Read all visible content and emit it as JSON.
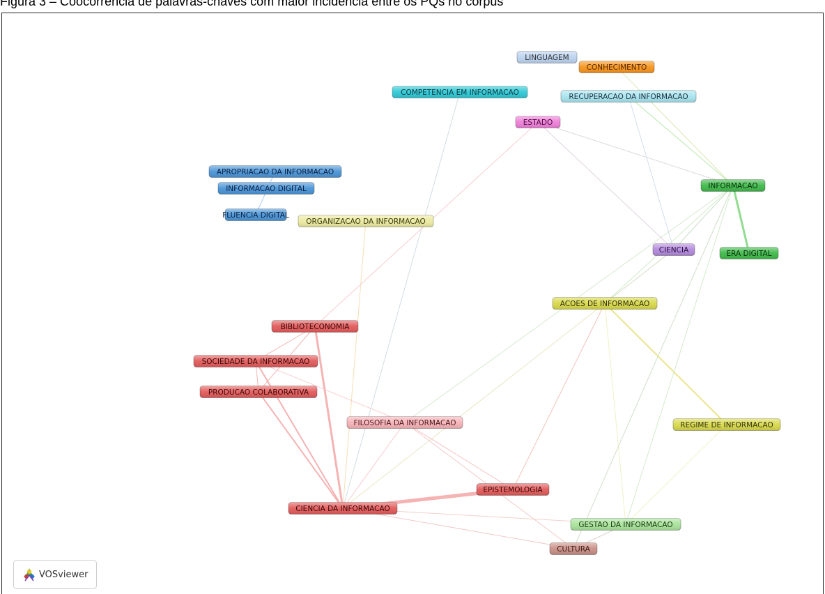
{
  "caption": "Figura 3 – Coocorrência de palavras-chaves com maior incidência entre os PQs no corpus",
  "logo_text": "VOSviewer",
  "nodes": [
    {
      "id": "linguagem",
      "label": "LINGUAGEM",
      "color": "#bcd3ef",
      "text": "#333"
    },
    {
      "id": "conhecimento",
      "label": "CONHECIMENTO",
      "color": "#f7941d",
      "text": "#5a2a00"
    },
    {
      "id": "competencia",
      "label": "COMPETENCIA EM INFORMACAO",
      "color": "#2ec8d6",
      "text": "#0b3a40"
    },
    {
      "id": "recuperacao",
      "label": "RECUPERACAO DA INFORMACAO",
      "color": "#a7e4ee",
      "text": "#234"
    },
    {
      "id": "estado",
      "label": "ESTADO",
      "color": "#ee7fd8",
      "text": "#4a0a3d"
    },
    {
      "id": "apropriacao",
      "label": "APROPRIACAO DA INFORMACAO",
      "color": "#4a94d6",
      "text": "#0b1f40"
    },
    {
      "id": "infodigital",
      "label": "INFORMACAO DIGITAL",
      "color": "#4a94d6",
      "text": "#0b1f40"
    },
    {
      "id": "informacao",
      "label": "INFORMACAO",
      "color": "#3fb94a",
      "text": "#07300a"
    },
    {
      "id": "fluencia",
      "label": "FLUENCIA DIGITAL",
      "color": "#4a94d6",
      "text": "#0b1f40"
    },
    {
      "id": "organizacao",
      "label": "ORGANIZACAO DA INFORMACAO",
      "color": "#eceaa0",
      "text": "#3a3a10"
    },
    {
      "id": "ciencia",
      "label": "CIENCIA",
      "color": "#b389dc",
      "text": "#2a1040"
    },
    {
      "id": "eradigital",
      "label": "ERA DIGITAL",
      "color": "#3fb94a",
      "text": "#07300a"
    },
    {
      "id": "acoes",
      "label": "ACOES DE INFORMACAO",
      "color": "#d8d84a",
      "text": "#333310"
    },
    {
      "id": "biblioteconomia",
      "label": "BIBLIOTECONOMIA",
      "color": "#e25a5a",
      "text": "#3a0808"
    },
    {
      "id": "sociedade",
      "label": "SOCIEDADE DA INFORMACAO",
      "color": "#e25a5a",
      "text": "#3a0808"
    },
    {
      "id": "producao",
      "label": "PRODUCAO COLABORATIVA",
      "color": "#e25a5a",
      "text": "#3a0808"
    },
    {
      "id": "filosofia",
      "label": "FILOSOFIA DA INFORMACAO",
      "color": "#f7b3b8",
      "text": "#4a1a1e"
    },
    {
      "id": "regime",
      "label": "REGIME DE INFORMACAO",
      "color": "#d8d84a",
      "text": "#333310"
    },
    {
      "id": "epistemologia",
      "label": "EPISTEMOLOGIA",
      "color": "#e25a5a",
      "text": "#3a0808"
    },
    {
      "id": "cienciainfo",
      "label": "CIENCIA DA INFORMACAO",
      "color": "#e25a5a",
      "text": "#3a0808"
    },
    {
      "id": "gestao",
      "label": "GESTAO DA INFORMACAO",
      "color": "#a8e29a",
      "text": "#1a3a10"
    },
    {
      "id": "cultura",
      "label": "CULTURA",
      "color": "#c98f86",
      "text": "#3a1a14"
    }
  ],
  "edges": [
    {
      "a": "cienciainfo",
      "b": "epistemologia",
      "color": "#f4a6a6",
      "w": 5
    },
    {
      "a": "cienciainfo",
      "b": "biblioteconomia",
      "color": "#f4a6a6",
      "w": 3
    },
    {
      "a": "cienciainfo",
      "b": "sociedade",
      "color": "#f4a6a6",
      "w": 2
    },
    {
      "a": "cienciainfo",
      "b": "producao",
      "color": "#f4a6a6",
      "w": 2
    },
    {
      "a": "cienciainfo",
      "b": "filosofia",
      "color": "#f7c4c8",
      "w": 1
    },
    {
      "a": "cienciainfo",
      "b": "organizacao",
      "color": "#f5d9a8",
      "w": 1
    },
    {
      "a": "cienciainfo",
      "b": "competencia",
      "color": "#c9d7dc",
      "w": 1
    },
    {
      "a": "cienciainfo",
      "b": "acoes",
      "color": "#e6e2b8",
      "w": 1
    },
    {
      "a": "cienciainfo",
      "b": "gestao",
      "color": "#f0c8c0",
      "w": 1
    },
    {
      "a": "cienciainfo",
      "b": "cultura",
      "color": "#f0c0c0",
      "w": 1
    },
    {
      "a": "biblioteconomia",
      "b": "sociedade",
      "color": "#f4a6a6",
      "w": 1
    },
    {
      "a": "biblioteconomia",
      "b": "producao",
      "color": "#f4a6a6",
      "w": 1
    },
    {
      "a": "biblioteconomia",
      "b": "estado",
      "color": "#f7c4c8",
      "w": 1
    },
    {
      "a": "sociedade",
      "b": "producao",
      "color": "#f4a6a6",
      "w": 1
    },
    {
      "a": "sociedade",
      "b": "filosofia",
      "color": "#f7c4c8",
      "w": 1
    },
    {
      "a": "filosofia",
      "b": "epistemologia",
      "color": "#f4b6b6",
      "w": 1
    },
    {
      "a": "filosofia",
      "b": "informacao",
      "color": "#cfe6c8",
      "w": 1
    },
    {
      "a": "filosofia",
      "b": "cultura",
      "color": "#f0c0c0",
      "w": 1
    },
    {
      "a": "epistemologia",
      "b": "acoes",
      "color": "#f0b8b0",
      "w": 1
    },
    {
      "a": "acoes",
      "b": "regime",
      "color": "#e8e078",
      "w": 2
    },
    {
      "a": "acoes",
      "b": "gestao",
      "color": "#eeeebb",
      "w": 1
    },
    {
      "a": "acoes",
      "b": "informacao",
      "color": "#c8e8bf",
      "w": 1
    },
    {
      "a": "acoes",
      "b": "ciencia",
      "color": "#cfd6bd",
      "w": 1
    },
    {
      "a": "regime",
      "b": "gestao",
      "color": "#eef0c0",
      "w": 1
    },
    {
      "a": "informacao",
      "b": "eradigital",
      "color": "#7ed67e",
      "w": 3
    },
    {
      "a": "informacao",
      "b": "recuperacao",
      "color": "#a8e29a",
      "w": 1
    },
    {
      "a": "informacao",
      "b": "conhecimento",
      "color": "#d8e2a8",
      "w": 1
    },
    {
      "a": "informacao",
      "b": "estado",
      "color": "#d8cfd8",
      "w": 1
    },
    {
      "a": "informacao",
      "b": "ciencia",
      "color": "#c0d8c0",
      "w": 1
    },
    {
      "a": "informacao",
      "b": "gestao",
      "color": "#c8e8c0",
      "w": 1
    },
    {
      "a": "informacao",
      "b": "cultura",
      "color": "#c8d8c0",
      "w": 1
    },
    {
      "a": "estado",
      "b": "ciencia",
      "color": "#dccddc",
      "w": 1
    },
    {
      "a": "recuperacao",
      "b": "ciencia",
      "color": "#c8d8e8",
      "w": 1
    },
    {
      "a": "apropriacao",
      "b": "fluencia",
      "color": "#9cc4e8",
      "w": 1
    },
    {
      "a": "gestao",
      "b": "cultura",
      "color": "#d8c8c0",
      "w": 1
    }
  ]
}
